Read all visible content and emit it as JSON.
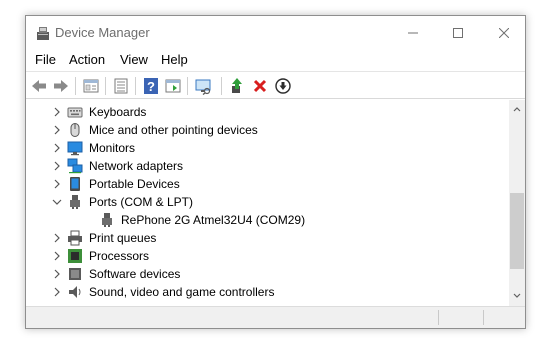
{
  "window": {
    "title": "Device Manager",
    "controls": [
      "minimize",
      "maximize",
      "close"
    ]
  },
  "menu": {
    "items": [
      "File",
      "Action",
      "View",
      "Help"
    ]
  },
  "toolbar": {
    "buttons": [
      "back-arrow-icon",
      "forward-arrow-icon",
      "properties-sheet-icon",
      "device-list-icon",
      "help-icon",
      "action-panel-icon",
      "scan-hardware-icon",
      "update-driver-icon",
      "uninstall-icon",
      "disable-device-icon"
    ],
    "uninstall_color": "#d81e1e",
    "update_color": "#2f9e3a"
  },
  "tree": {
    "rows": [
      {
        "label": "Keyboards",
        "icon": "keyboard-icon",
        "expanded": false
      },
      {
        "label": "Mice and other pointing devices",
        "icon": "mouse-icon",
        "expanded": false
      },
      {
        "label": "Monitors",
        "icon": "monitor-icon",
        "expanded": false
      },
      {
        "label": "Network adapters",
        "icon": "network-adapter-icon",
        "expanded": false
      },
      {
        "label": "Portable Devices",
        "icon": "portable-device-icon",
        "expanded": false
      },
      {
        "label": "Ports (COM & LPT)",
        "icon": "port-icon",
        "expanded": true
      },
      {
        "label": "RePhone 2G Atmel32U4 (COM29)",
        "icon": "port-icon",
        "child": true
      },
      {
        "label": "Print queues",
        "icon": "printer-icon",
        "expanded": false
      },
      {
        "label": "Processors",
        "icon": "processor-icon",
        "expanded": false
      },
      {
        "label": "Software devices",
        "icon": "software-device-icon",
        "expanded": false
      },
      {
        "label": "Sound, video and game controllers",
        "icon": "speaker-icon",
        "expanded": false
      }
    ]
  },
  "colors": {
    "accent": "#1e7ad8",
    "selection": "#cce8ff"
  }
}
